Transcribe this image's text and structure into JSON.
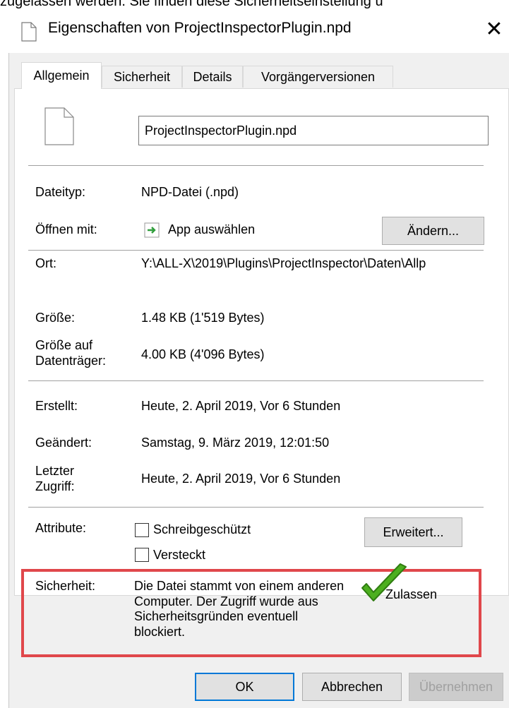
{
  "background_text": "zugelassen werden. Sie finden diese Sicherheitseinstellung u",
  "window": {
    "title": "Eigenschaften von ProjectInspectorPlugin.npd",
    "close_glyph": "✕"
  },
  "tabs": [
    {
      "label": "Allgemein",
      "active": true
    },
    {
      "label": "Sicherheit",
      "active": false
    },
    {
      "label": "Details",
      "active": false
    },
    {
      "label": "Vorgängerversionen",
      "active": false
    }
  ],
  "general": {
    "filename": "ProjectInspectorPlugin.npd",
    "filetype_label": "Dateityp:",
    "filetype_value": "NPD-Datei (.npd)",
    "openwith_label": "Öffnen mit:",
    "openwith_value": "App auswählen",
    "change_button": "Ändern...",
    "location_label": "Ort:",
    "location_value": "Y:\\ALL-X\\2019\\Plugins\\ProjectInspector\\Daten\\Allp",
    "size_label": "Größe:",
    "size_value": "1.48 KB (1'519 Bytes)",
    "size_on_disk_label_line1": "Größe auf",
    "size_on_disk_label_line2": "Datenträger:",
    "size_on_disk_value": "4.00 KB (4'096 Bytes)",
    "created_label": "Erstellt:",
    "created_value": "Heute, 2. April 2019, Vor 6 Stunden",
    "modified_label": "Geändert:",
    "modified_value": "Samstag, 9. März 2019, 12:01:50",
    "accessed_label_line1": "Letzter",
    "accessed_label_line2": "Zugriff:",
    "accessed_value": "Heute, 2. April 2019, Vor 6 Stunden",
    "attributes_label": "Attribute:",
    "readonly_label": "Schreibgeschützt",
    "readonly_checked": false,
    "hidden_label": "Versteckt",
    "hidden_checked": false,
    "advanced_button": "Erweitert...",
    "security_label": "Sicherheit:",
    "security_text": "Die Datei stammt von einem anderen Computer. Der Zugriff wurde aus Sicherheitsgründen eventuell blockiert.",
    "allow_label": "Zulassen",
    "allow_checked": true
  },
  "buttons": {
    "ok": "OK",
    "cancel": "Abbrechen",
    "apply": "Übernehmen"
  },
  "colors": {
    "highlight_border": "#e0474b",
    "checkmark_green": "#4caf1f",
    "default_button_border": "#0078d7"
  }
}
